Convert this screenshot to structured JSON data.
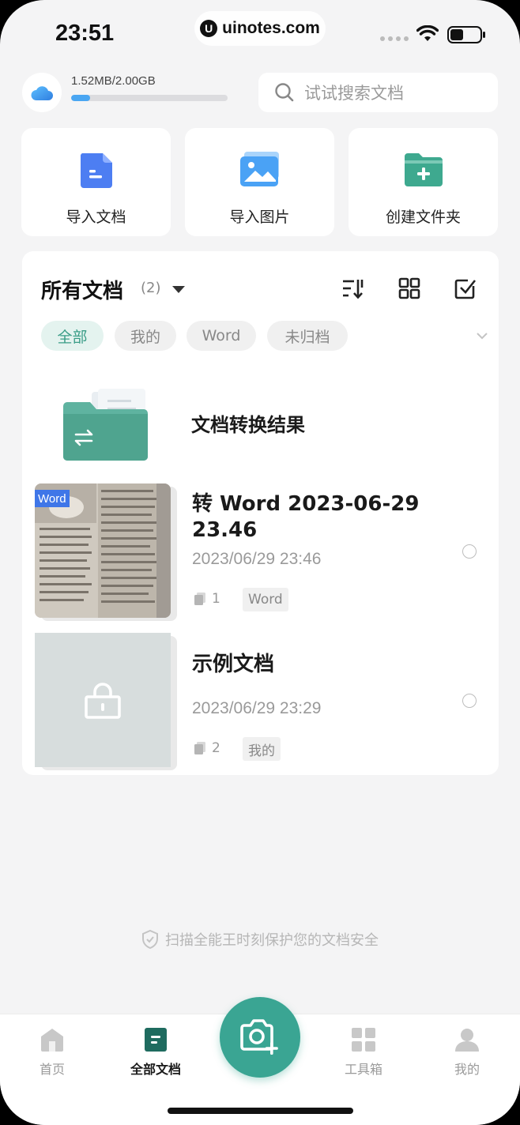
{
  "status_bar": {
    "time": "23:51",
    "watermark": "uinotes.com",
    "watermark_logo": "U"
  },
  "storage": {
    "text": "1.52MB/2.00GB",
    "used_fraction": 0.12
  },
  "search": {
    "placeholder": "试试搜索文档"
  },
  "quick_actions": [
    {
      "label": "导入文档",
      "icon": "import-document-icon"
    },
    {
      "label": "导入图片",
      "icon": "import-image-icon"
    },
    {
      "label": "创建文件夹",
      "icon": "create-folder-icon"
    }
  ],
  "documents": {
    "title": "所有文档",
    "count": "(2)",
    "filters": [
      "全部",
      "我的",
      "Word",
      "未归档"
    ],
    "active_filter": "全部",
    "folder": {
      "name": "文档转换结果"
    },
    "items": [
      {
        "title": "转 Word 2023-06-29 23.46",
        "date": "2023/06/29 23:46",
        "pages": "1",
        "tag": "Word",
        "thumb_badge": "Word"
      },
      {
        "title": "示例文档",
        "date": "2023/06/29 23:29",
        "pages": "2",
        "tag": "我的"
      }
    ]
  },
  "security_note": "扫描全能王时刻保护您的文档安全",
  "bottom_nav": [
    {
      "label": "首页",
      "icon": "home-icon"
    },
    {
      "label": "全部文档",
      "icon": "all-documents-icon",
      "active": true
    },
    {
      "label": "工具箱",
      "icon": "toolbox-icon"
    },
    {
      "label": "我的",
      "icon": "profile-icon"
    }
  ],
  "colors": {
    "accent": "#3aa593",
    "storage_fill": "#4aa6f2",
    "background": "#f4f4f5"
  }
}
